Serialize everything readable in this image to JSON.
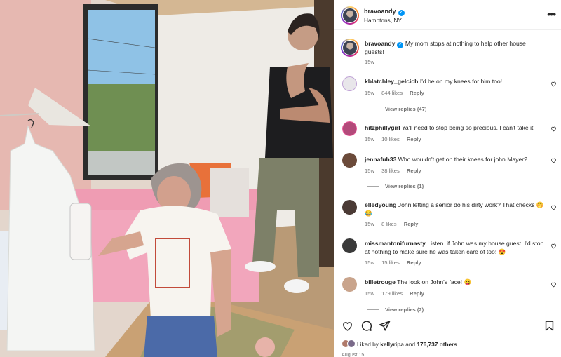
{
  "post": {
    "username": "bravoandy",
    "location": "Hamptons, NY",
    "more_label": "•••"
  },
  "caption": {
    "username": "bravoandy",
    "text": "My mom stops at nothing to help other house guests!",
    "time": "15w"
  },
  "comments": [
    {
      "username": "kblatchley_gelcich",
      "text": "I'd be on my knees for him too!",
      "time": "15w",
      "likes": "844 likes",
      "reply": "Reply",
      "view_replies": "View replies (47)",
      "avatar_color": "#e8e6ea"
    },
    {
      "username": "hitzphillygirl",
      "text": "Ya'll need to stop being so precious. I can't take it.",
      "time": "15w",
      "likes": "10 likes",
      "reply": "Reply",
      "view_replies": "",
      "avatar_color": "#b34a7a"
    },
    {
      "username": "jennafuh33",
      "text": "Who wouldn't get on their knees for john Mayer?",
      "time": "15w",
      "likes": "38 likes",
      "reply": "Reply",
      "view_replies": "View replies (1)",
      "avatar_color": "#6b4a3a"
    },
    {
      "username": "elledyoung",
      "text": "John letting a senior do his dirty work? That checks 🤭😂",
      "time": "15w",
      "likes": "8 likes",
      "reply": "Reply",
      "view_replies": "",
      "avatar_color": "#4a3a35"
    },
    {
      "username": "missmantonifurnasty",
      "text": "Listen. if John was my house guest. I'd stop at nothing to make sure he was taken care of too! 😍",
      "time": "15w",
      "likes": "15 likes",
      "reply": "Reply",
      "view_replies": "",
      "avatar_color": "#3a3a3a"
    },
    {
      "username": "billetrouge",
      "text": "The look on John's face! 😝",
      "time": "15w",
      "likes": "179 likes",
      "reply": "Reply",
      "view_replies": "View replies (2)",
      "avatar_color": "#c9a48c"
    }
  ],
  "actions": {
    "liked_prefix": "Liked by",
    "liked_user": "kellyripa",
    "liked_mid": "and",
    "liked_count": "176,737 others",
    "date": "August 15"
  },
  "icons": {
    "more": "more-options-icon",
    "verified": "verified-badge-icon",
    "like": "heart-icon",
    "comment": "comment-icon",
    "share": "share-icon",
    "save": "bookmark-icon"
  },
  "colors": {
    "verified": "#0095f6",
    "secondary_text": "#737373",
    "divider": "#efefef"
  }
}
